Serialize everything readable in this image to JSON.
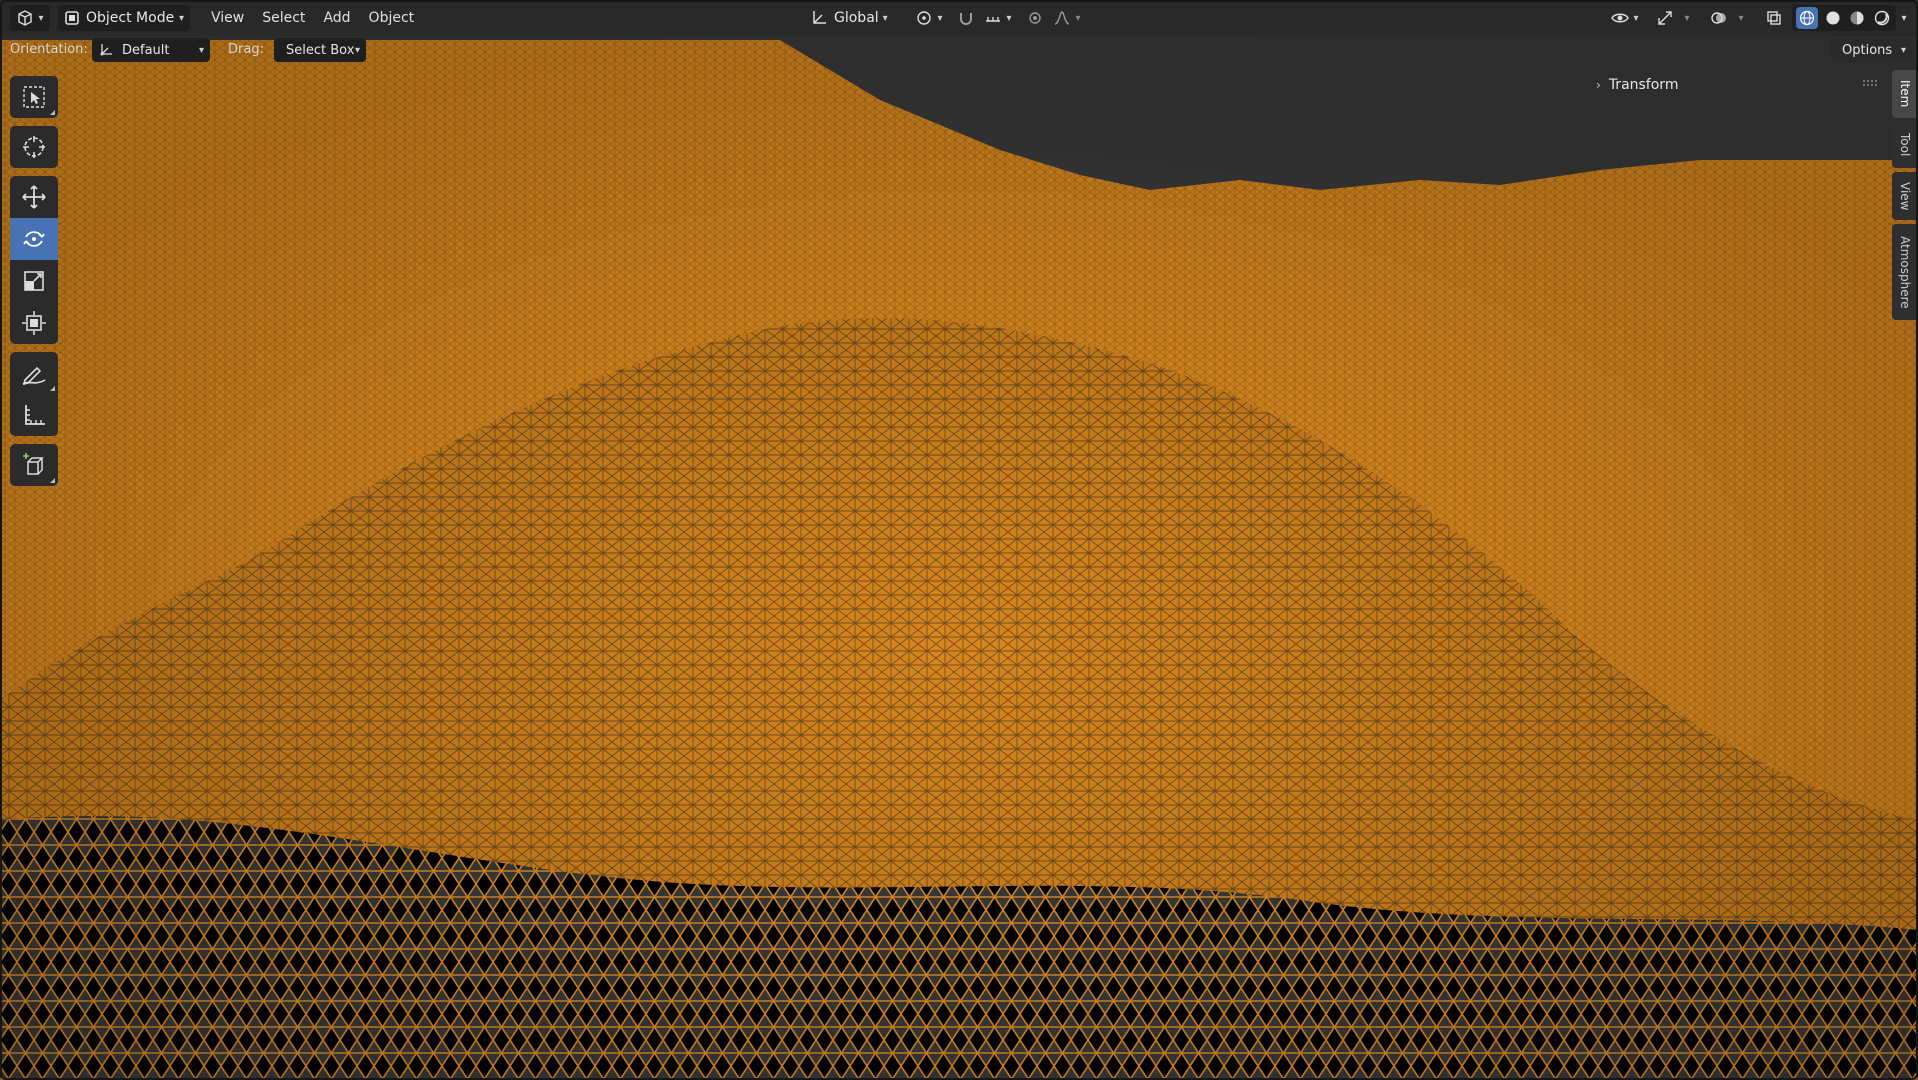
{
  "header": {
    "mode_label": "Object Mode",
    "menus": [
      "View",
      "Select",
      "Add",
      "Object"
    ],
    "transform_orientation": "Global"
  },
  "tool_header": {
    "orientation_label": "Orientation:",
    "orientation_value": "Default",
    "drag_label": "Drag:",
    "drag_value": "Select Box",
    "options_label": "Options"
  },
  "toolbar": {
    "tools": [
      {
        "name": "select-box-tool",
        "icon": "select-box-icon"
      },
      {
        "name": "cursor-tool",
        "icon": "cursor-icon"
      },
      {
        "name": "move-tool",
        "icon": "move-icon"
      },
      {
        "name": "rotate-tool",
        "icon": "rotate-icon",
        "active": true
      },
      {
        "name": "scale-tool",
        "icon": "scale-icon"
      },
      {
        "name": "transform-tool",
        "icon": "transform-icon"
      },
      {
        "name": "annotate-tool",
        "icon": "annotate-icon"
      },
      {
        "name": "measure-tool",
        "icon": "measure-icon"
      },
      {
        "name": "add-cube-tool",
        "icon": "add-cube-icon"
      }
    ]
  },
  "sidebar": {
    "tabs": [
      "Item",
      "Tool",
      "View",
      "Atmosphere"
    ],
    "active_tab": "Item",
    "panel_title": "Transform"
  },
  "viewport": {
    "shading": "wireframe",
    "wire_color": "#f29a26",
    "background_color": "#3c3c3c"
  },
  "colors": {
    "accent": "#4772b3",
    "header_bg": "#282828",
    "wire": "#f29a26"
  }
}
